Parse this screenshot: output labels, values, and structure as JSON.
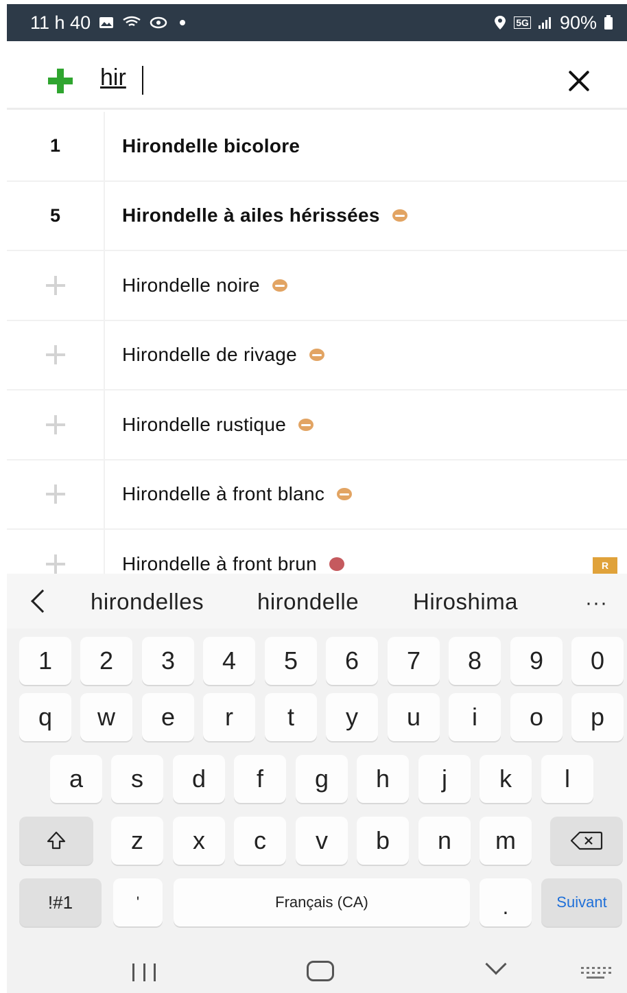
{
  "status_bar": {
    "time": "11 h 40",
    "battery": "90%",
    "network": "5G"
  },
  "search": {
    "value": "hir",
    "icons": [
      "add-icon",
      "close-icon"
    ]
  },
  "results": [
    {
      "count": "1",
      "name": "Hirondelle bicolore",
      "bold": true,
      "status": null,
      "badge": null
    },
    {
      "count": "5",
      "name": "Hirondelle à ailes hérissées",
      "bold": true,
      "status": "half",
      "badge": null
    },
    {
      "count": null,
      "name": "Hirondelle noire",
      "bold": false,
      "status": "half",
      "badge": null
    },
    {
      "count": null,
      "name": "Hirondelle de rivage",
      "bold": false,
      "status": "half",
      "badge": null
    },
    {
      "count": null,
      "name": "Hirondelle rustique",
      "bold": false,
      "status": "half",
      "badge": null
    },
    {
      "count": null,
      "name": "Hirondelle à front blanc",
      "bold": false,
      "status": "half",
      "badge": null
    },
    {
      "count": null,
      "name": "Hirondelle à front brun",
      "bold": false,
      "status": "full",
      "badge": "R"
    }
  ],
  "colors": {
    "status_bar_bg": "#2d3a48",
    "add_green": "#2fa52f",
    "status_half": "#e2a463",
    "status_full": "#c55a5e",
    "badge": "#e0a23a",
    "action_key": "#1e6fd8"
  },
  "keyboard": {
    "suggestions": [
      "hirondelles",
      "hirondelle",
      "Hiroshima"
    ],
    "more": "···",
    "number_row": [
      "1",
      "2",
      "3",
      "4",
      "5",
      "6",
      "7",
      "8",
      "9",
      "0"
    ],
    "row1": [
      "q",
      "w",
      "e",
      "r",
      "t",
      "y",
      "u",
      "i",
      "o",
      "p"
    ],
    "row2": [
      "a",
      "s",
      "d",
      "f",
      "g",
      "h",
      "j",
      "k",
      "l"
    ],
    "row3": [
      "z",
      "x",
      "c",
      "v",
      "b",
      "n",
      "m"
    ],
    "symbols_key": "!#1",
    "apostrophe_key": "'",
    "space_key": "Français (CA)",
    "period_key": ".",
    "action_key": "Suivant"
  }
}
